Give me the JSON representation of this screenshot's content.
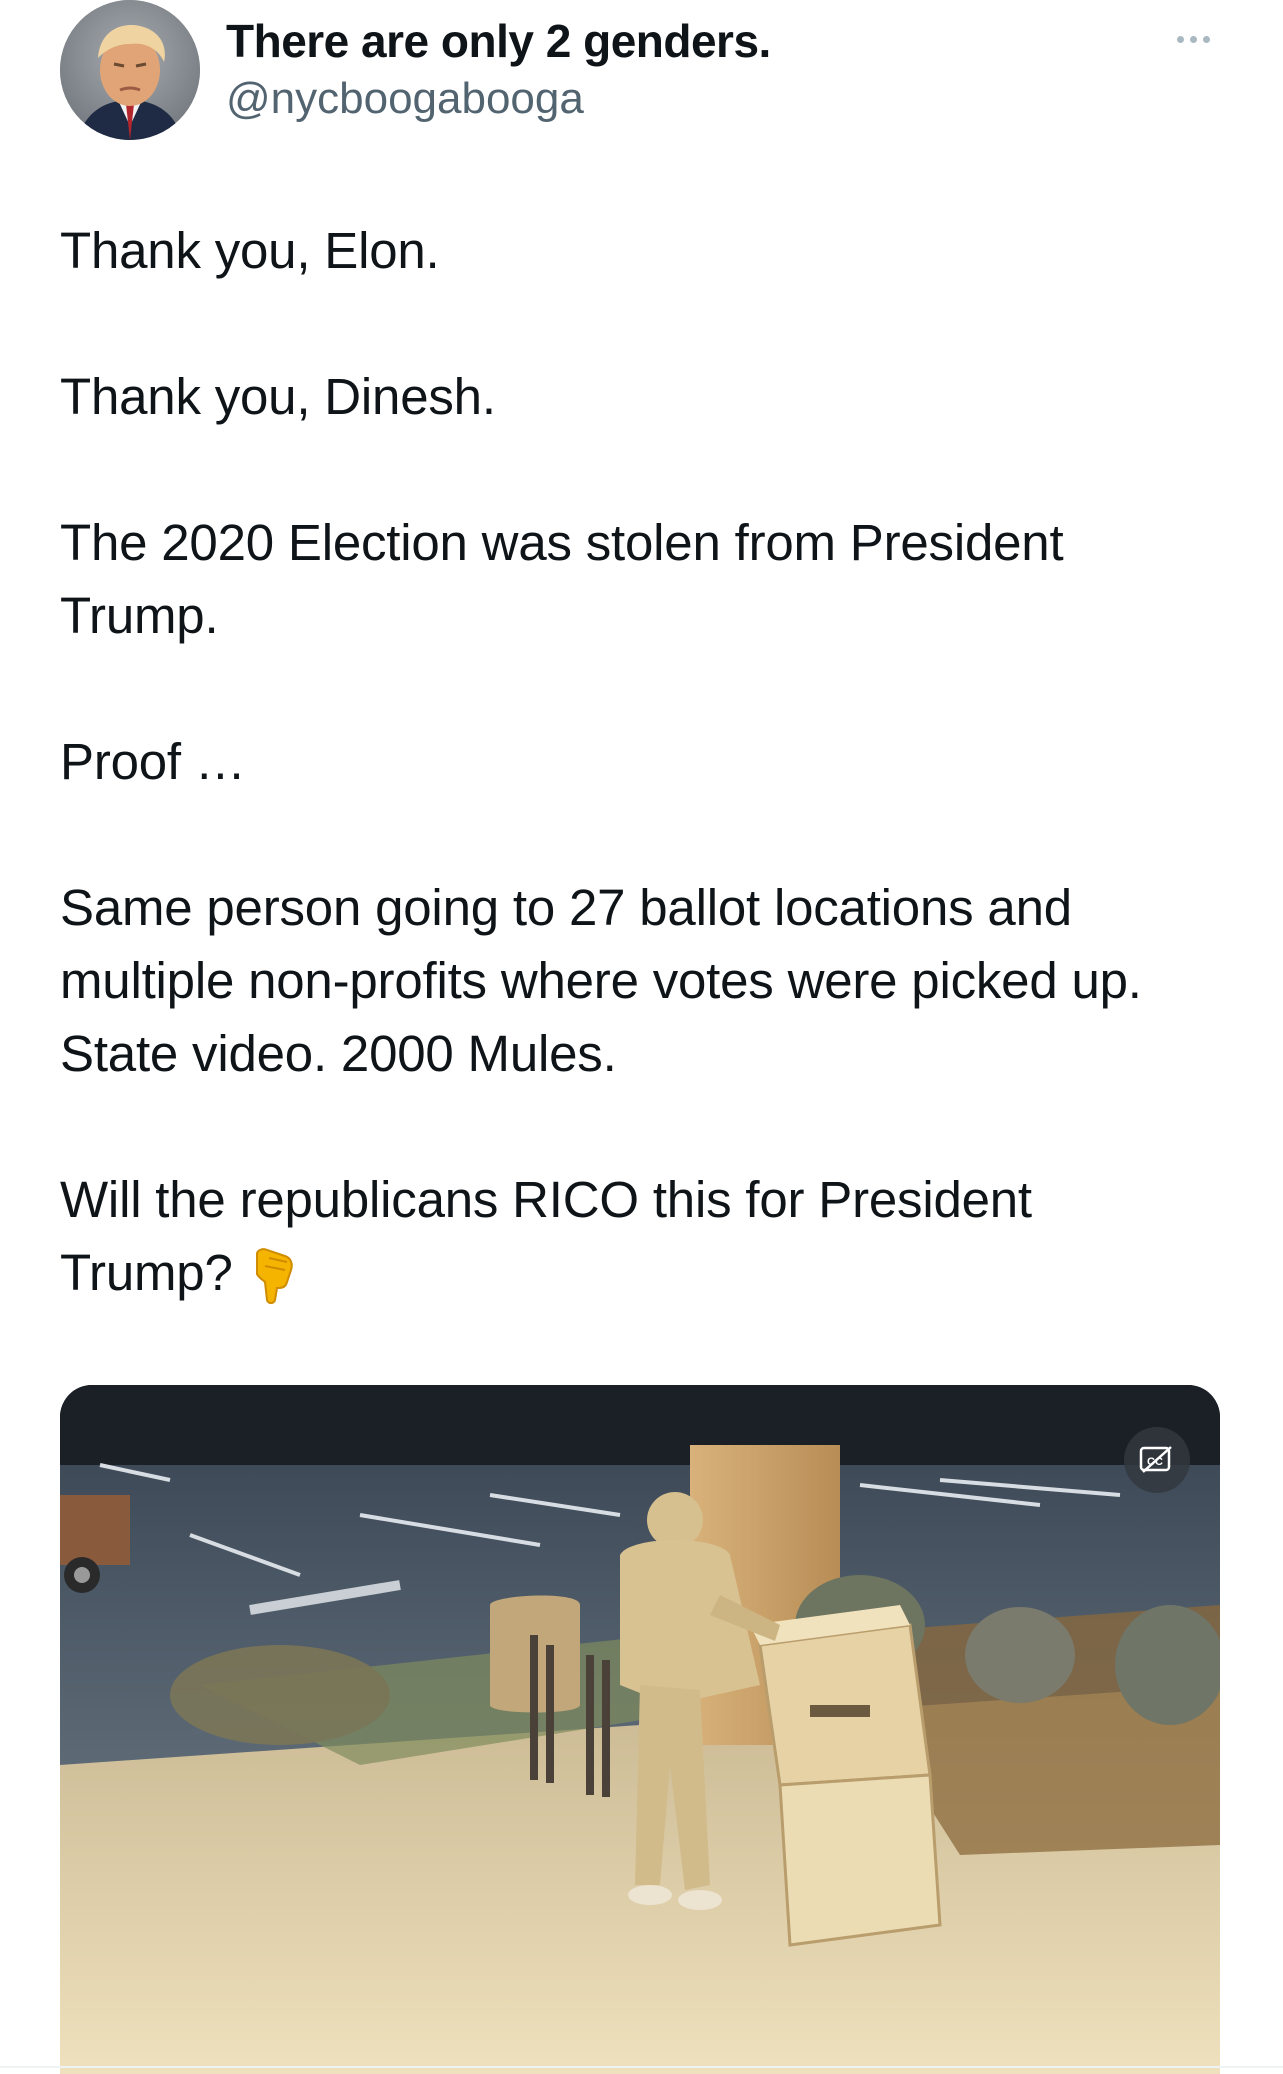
{
  "tweet": {
    "author": {
      "display_name": "There are only 2 genders.",
      "handle": "@nycboogabooga",
      "avatar_icon": "profile-photo"
    },
    "more_icon": "more-dots-icon",
    "paragraphs": [
      "Thank you, Elon.",
      "Thank you, Dinesh.",
      "The 2020 Election was stolen from President Trump.",
      "Proof …",
      "Same person going to 27 ballot locations and multiple non-profits where votes were picked up. State video. 2000 Mules.",
      "Will the republicans RICO this for President Trump?"
    ],
    "trailing_emoji_icon": "backhand-index-pointing-down-emoji",
    "media": {
      "type": "video",
      "captions_icon": "closed-captions-icon"
    }
  },
  "colors": {
    "text": "#0f1419",
    "secondary_text": "#536471",
    "background": "#ffffff"
  }
}
